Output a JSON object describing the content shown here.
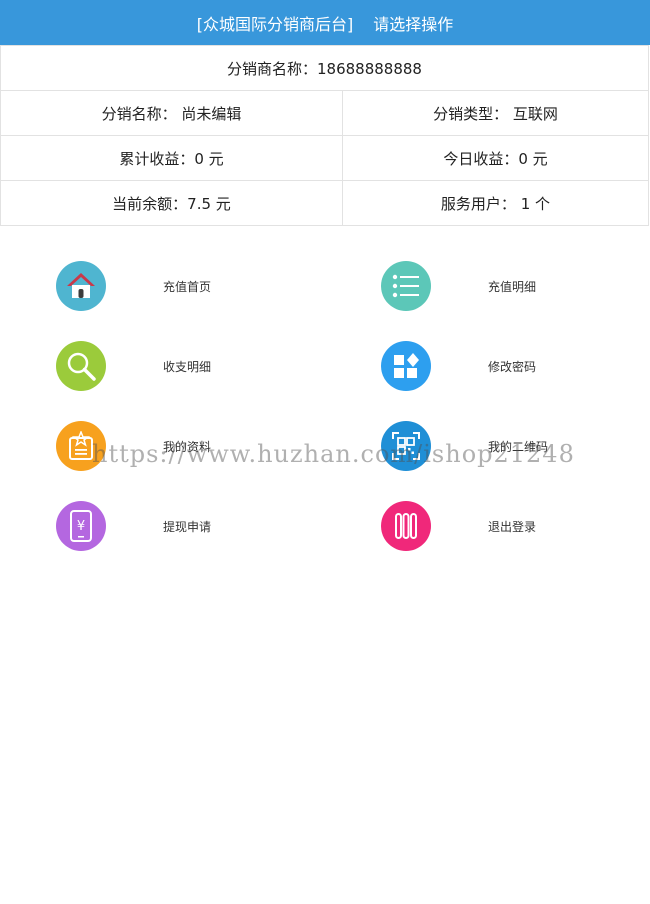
{
  "header": {
    "title": "[众城国际分销商后台]",
    "subtitle": "请选择操作"
  },
  "info": {
    "distributor_account": "分销商名称：18688888888",
    "distributor_name": "分销名称： 尚未编辑",
    "distributor_type": "分销类型： 互联网",
    "total_income": "累计收益：0 元",
    "today_income": "今日收益：0 元",
    "balance": "当前余额：7.5 元",
    "service_users": "服务用户： 1 个"
  },
  "menu": {
    "recharge_home": "充值首页",
    "recharge_detail": "充值明细",
    "income_detail": "收支明细",
    "change_password": "修改密码",
    "my_profile": "我的资料",
    "my_qrcode": "我的二维码",
    "withdraw_apply": "提现申请",
    "logout": "退出登录"
  },
  "watermark": "https://www.huzhan.com/ishop21248",
  "colors": {
    "header_bg": "#3897db",
    "home_icon": "#4fb5d0",
    "list_icon": "#5cc7b8",
    "search_icon": "#9bcb3b",
    "password_icon": "#2d9fef",
    "profile_icon": "#f7a11e",
    "qrcode_icon": "#1f8fd6",
    "withdraw_icon": "#b467e0",
    "logout_icon": "#f0287a"
  }
}
